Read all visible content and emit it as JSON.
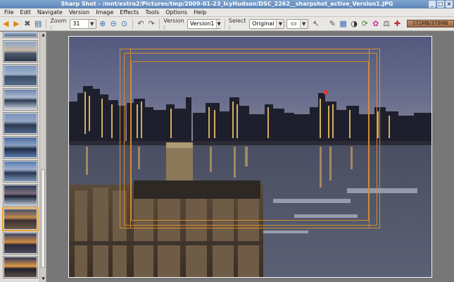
{
  "window": {
    "title": "Sharp Shot - /mnt/extra2/Pictures/tmp/2009-01-23_IcyHudson/DSC_2262__sharpshot_active_Version1.JPG"
  },
  "menu": {
    "items": [
      "File",
      "Edit",
      "Navigate",
      "Version",
      "Image",
      "Effects",
      "Tools",
      "Options",
      "Help"
    ]
  },
  "toolbar": {
    "zoom_label": "Zoom :",
    "zoom_value": "31",
    "version_label": "Version :",
    "version_value": "Version1",
    "select_label": "Select :",
    "select_value": "Original",
    "memory": "171MB/379MB"
  },
  "icons": {
    "prev": "arrow-left-icon",
    "next": "arrow-right-icon",
    "tools": "tools-icon",
    "save": "save-icon",
    "zoom_in": "zoom-in-icon",
    "zoom_out": "zoom-out-icon",
    "zoom_fit": "zoom-fit-icon",
    "undo": "undo-icon",
    "redo": "redo-icon"
  },
  "colors": {
    "accent": "#e5a03a",
    "crop_guide": "#d68a2e",
    "memory_bar": "#9c6848"
  },
  "sidebar": {
    "thumb_count": 11,
    "selected_index": 8
  }
}
